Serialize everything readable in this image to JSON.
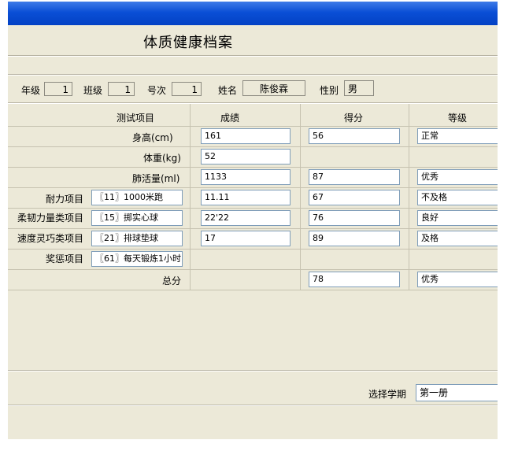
{
  "window": {
    "title": "体质健康档案"
  },
  "info": {
    "grade_label": "年级",
    "grade_value": "1",
    "class_label": "班级",
    "class_value": "1",
    "number_label": "号次",
    "number_value": "1",
    "name_label": "姓名",
    "name_value": "陈俊霖",
    "gender_label": "性别",
    "gender_value": "男"
  },
  "table": {
    "headers": {
      "item": "测试项目",
      "score": "成绩",
      "points": "得分",
      "level": "等级"
    },
    "rows": [
      {
        "label": "身高(cm)",
        "project": "",
        "score": "161",
        "points": "56",
        "level": "正常"
      },
      {
        "label": "体重(kg)",
        "project": "",
        "score": "52",
        "points": "",
        "level": ""
      },
      {
        "label": "肺活量(ml)",
        "project": "",
        "score": "1133",
        "points": "87",
        "level": "优秀"
      },
      {
        "label": "耐力项目",
        "project": "〖11〗1000米跑",
        "score": "11.11",
        "points": "67",
        "level": "不及格"
      },
      {
        "label": "柔韧力量类项目",
        "project": "〖15〗掷实心球",
        "score": "22'22",
        "points": "76",
        "level": "良好"
      },
      {
        "label": "速度灵巧类项目",
        "project": "〖21〗排球垫球",
        "score": "17",
        "points": "89",
        "level": "及格"
      },
      {
        "label": "奖惩项目",
        "project": "〖61〗每天锻炼1小时",
        "score": "",
        "points": "",
        "level": ""
      }
    ],
    "total": {
      "label": "总分",
      "points": "78",
      "level": "优秀"
    }
  },
  "semester": {
    "label": "选择学期",
    "value": "第一册"
  }
}
